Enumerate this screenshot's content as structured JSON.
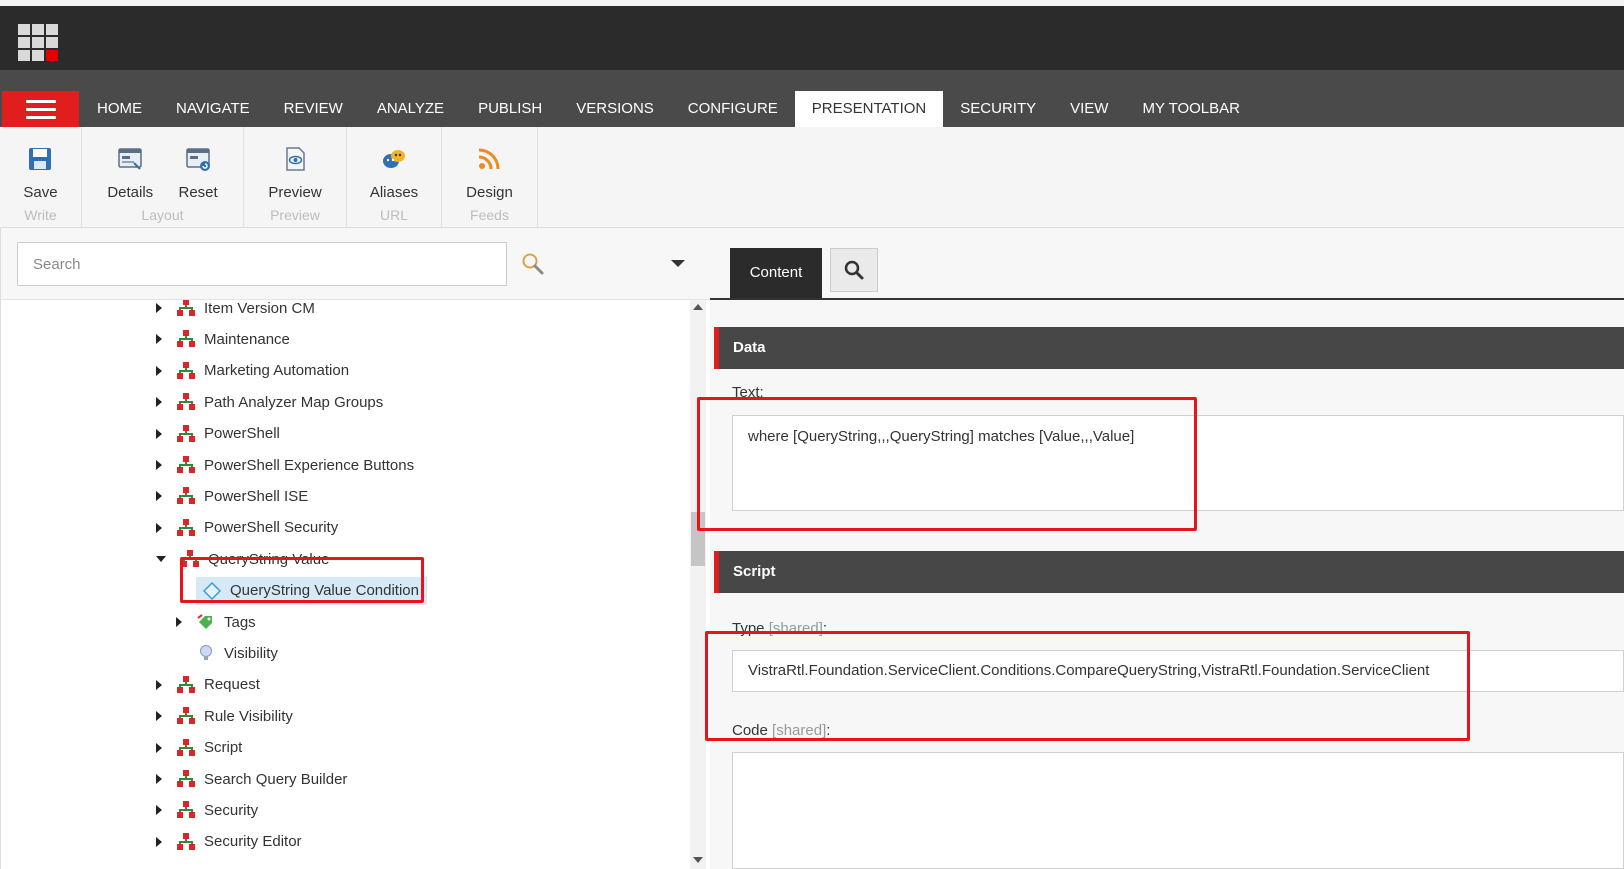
{
  "nav": {
    "tabs": [
      "HOME",
      "NAVIGATE",
      "REVIEW",
      "ANALYZE",
      "PUBLISH",
      "VERSIONS",
      "CONFIGURE",
      "PRESENTATION",
      "SECURITY",
      "VIEW",
      "MY TOOLBAR"
    ],
    "active_tab": "PRESENTATION"
  },
  "ribbon": {
    "groups": [
      {
        "name": "Write",
        "buttons": [
          {
            "label": "Save",
            "icon": "save-icon"
          }
        ]
      },
      {
        "name": "Layout",
        "buttons": [
          {
            "label": "Details",
            "icon": "layout-details-icon"
          },
          {
            "label": "Reset",
            "icon": "layout-reset-icon"
          }
        ]
      },
      {
        "name": "Preview",
        "buttons": [
          {
            "label": "Preview",
            "icon": "preview-icon"
          }
        ]
      },
      {
        "name": "URL",
        "buttons": [
          {
            "label": "Aliases",
            "icon": "aliases-icon"
          }
        ]
      },
      {
        "name": "Feeds",
        "buttons": [
          {
            "label": "Design",
            "icon": "rss-icon"
          }
        ]
      }
    ]
  },
  "search": {
    "placeholder": "Search"
  },
  "tree": {
    "items": [
      {
        "label": "Item Version CM",
        "state": "collapsed",
        "level": 0,
        "icon": "rule-group-icon"
      },
      {
        "label": "Maintenance",
        "state": "collapsed",
        "level": 0,
        "icon": "rule-group-icon"
      },
      {
        "label": "Marketing Automation",
        "state": "collapsed",
        "level": 0,
        "icon": "rule-group-icon"
      },
      {
        "label": "Path Analyzer Map Groups",
        "state": "collapsed",
        "level": 0,
        "icon": "rule-group-icon"
      },
      {
        "label": "PowerShell",
        "state": "collapsed",
        "level": 0,
        "icon": "rule-group-icon"
      },
      {
        "label": "PowerShell Experience Buttons",
        "state": "collapsed",
        "level": 0,
        "icon": "rule-group-icon"
      },
      {
        "label": "PowerShell ISE",
        "state": "collapsed",
        "level": 0,
        "icon": "rule-group-icon"
      },
      {
        "label": "PowerShell Security",
        "state": "collapsed",
        "level": 0,
        "icon": "rule-group-icon"
      },
      {
        "label": "QueryString Value",
        "state": "expanded",
        "level": 0,
        "icon": "rule-group-icon"
      },
      {
        "label": "QueryString Value Condition",
        "state": "leaf",
        "level": 1,
        "icon": "condition-icon",
        "selected": true
      },
      {
        "label": "Tags",
        "state": "collapsed",
        "level": 1,
        "icon": "tags-icon"
      },
      {
        "label": "Visibility",
        "state": "leaf",
        "level": 1,
        "icon": "lightbulb-icon"
      },
      {
        "label": "Request",
        "state": "collapsed",
        "level": 0,
        "icon": "rule-group-icon"
      },
      {
        "label": "Rule Visibility",
        "state": "collapsed",
        "level": 0,
        "icon": "rule-group-icon"
      },
      {
        "label": "Script",
        "state": "collapsed",
        "level": 0,
        "icon": "rule-group-icon"
      },
      {
        "label": "Search Query Builder",
        "state": "collapsed",
        "level": 0,
        "icon": "rule-group-icon"
      },
      {
        "label": "Security",
        "state": "collapsed",
        "level": 0,
        "icon": "rule-group-icon"
      },
      {
        "label": "Security Editor",
        "state": "collapsed",
        "level": 0,
        "icon": "rule-group-icon"
      }
    ]
  },
  "editor": {
    "content_tab": "Content",
    "sections": {
      "data": {
        "title": "Data",
        "text_label": "Text:",
        "text_value": "where [QueryString,,,QueryString] matches [Value,,,Value]"
      },
      "script": {
        "title": "Script",
        "type_label": "Type",
        "type_shared": "[shared]",
        "type_colon": ":",
        "type_value": "VistraRtl.Foundation.ServiceClient.Conditions.CompareQueryString,VistraRtl.Foundation.ServiceClient",
        "code_label": "Code",
        "code_shared": "[shared]",
        "code_colon": ":",
        "code_value": ""
      }
    }
  },
  "colors": {
    "accent_red": "#e01e1e",
    "header_dark": "#2b2b2b",
    "tab_bar": "#4a4a4a",
    "selection": "#d6e9f7",
    "annotation_red": "#e8141c"
  }
}
